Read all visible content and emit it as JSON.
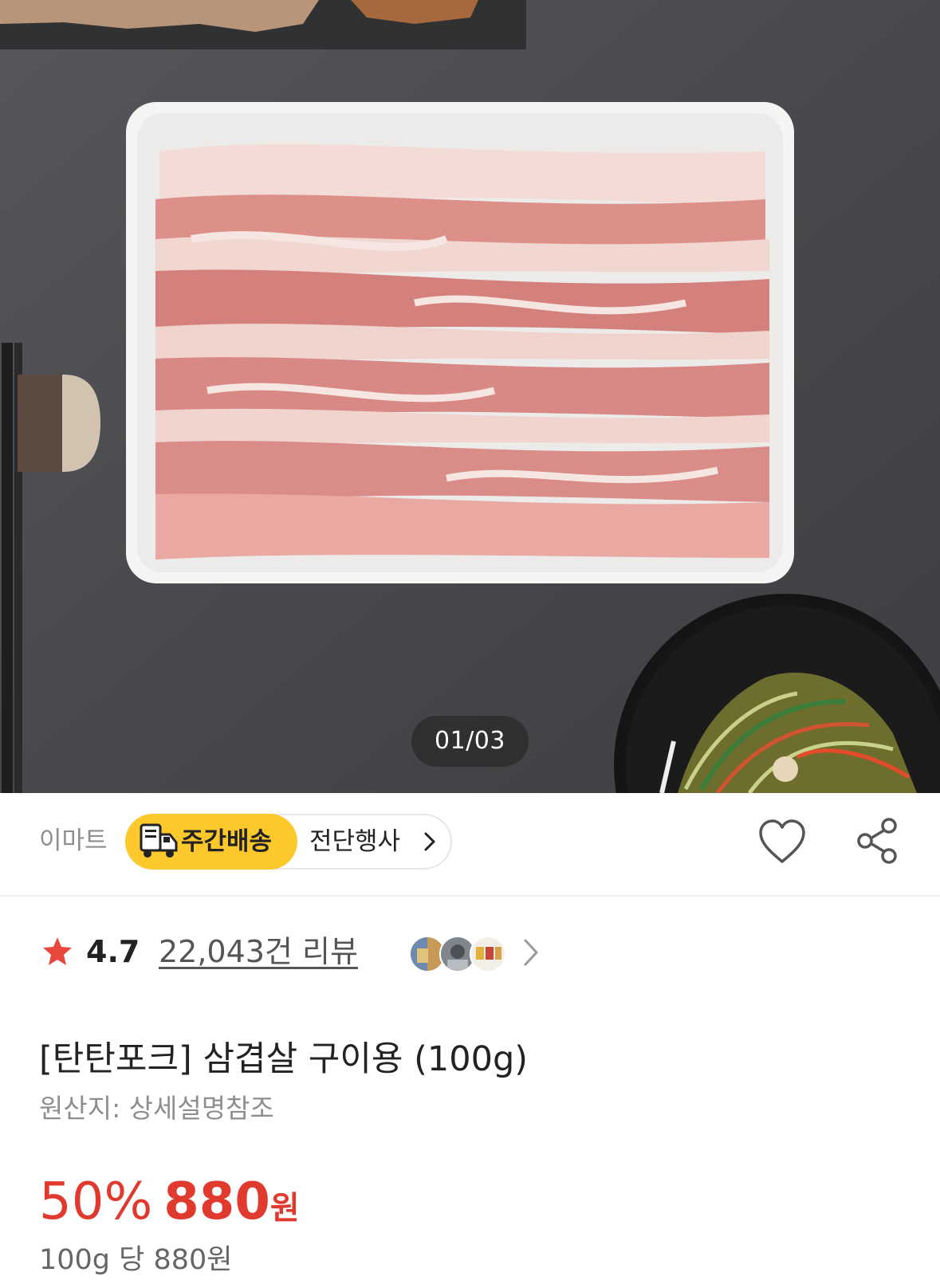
{
  "carousel": {
    "counter": "01/03"
  },
  "store": {
    "name": "이마트",
    "delivery_badge": "주간배송",
    "flyer_link": "전단행사",
    "icons": {
      "truck": "delivery-truck-icon",
      "chevron": "chevron-right-icon",
      "wishlist": "heart-icon",
      "share": "share-icon"
    }
  },
  "rating": {
    "score": "4.7",
    "reviews": "22,043건 리뷰",
    "star_color": "#e8473b"
  },
  "product": {
    "title": "[탄탄포크] 삼겹살 구이용 (100g)",
    "origin": "원산지: 상세설명참조"
  },
  "price": {
    "discount": "50%",
    "amount": "880",
    "currency": "원",
    "unit_price": "100g 당 880원",
    "color": "#e03a2f"
  },
  "colors": {
    "delivery_badge": "#fcc82c",
    "background_slate": "#4a4b4d"
  }
}
